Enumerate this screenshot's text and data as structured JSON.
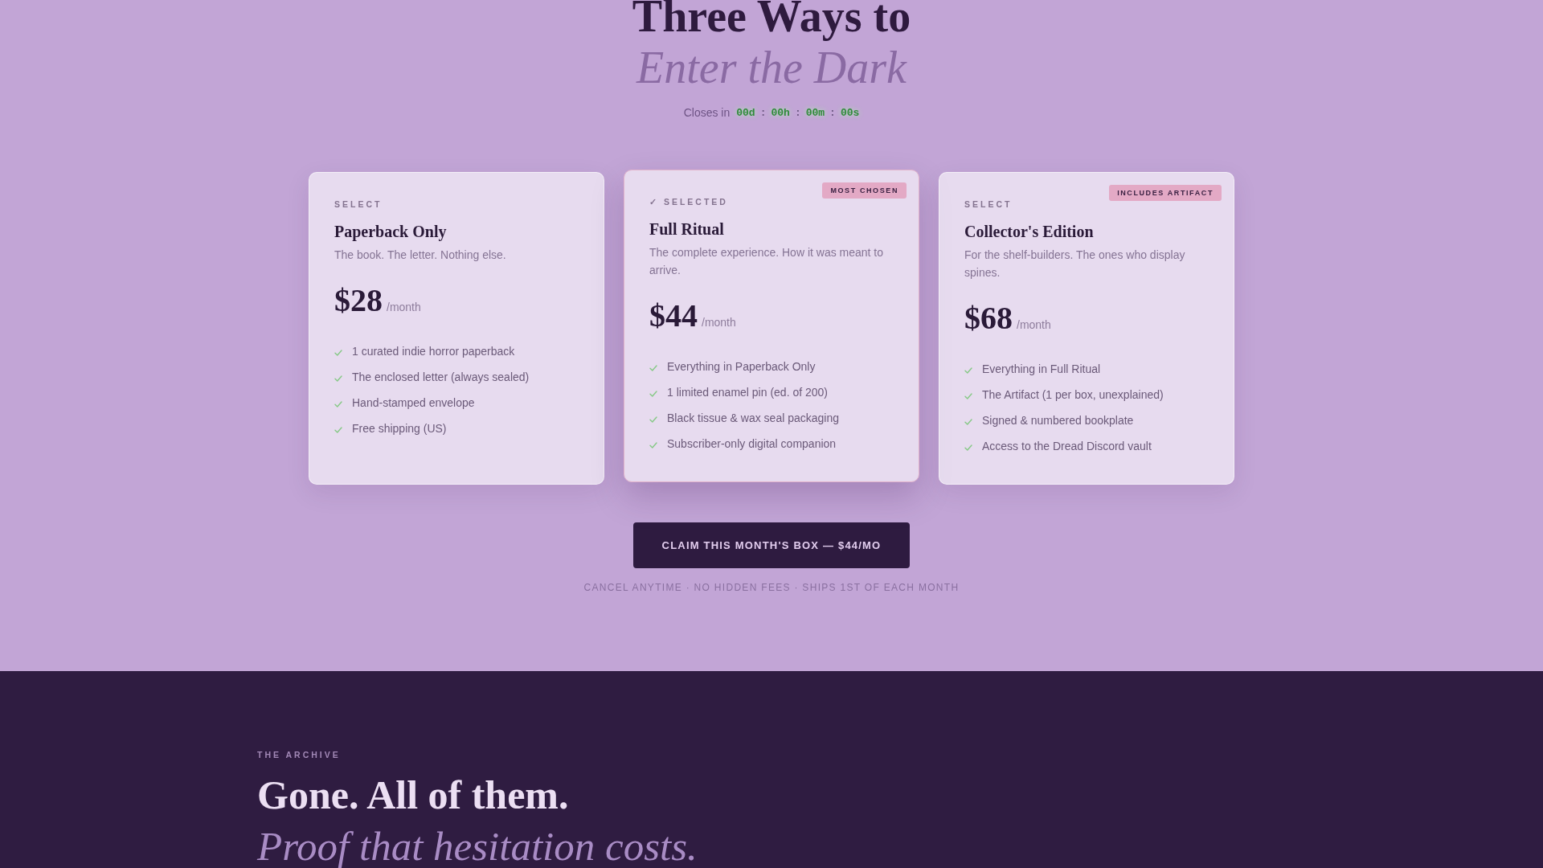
{
  "hero": {
    "title": "Three Ways to",
    "title_accent": "Enter the Dark",
    "countdown": {
      "label": "Closes in",
      "units": [
        "00d",
        "00h",
        "00m",
        "00s"
      ],
      "separator": ":"
    }
  },
  "plans": [
    {
      "select_label": "SELECT",
      "selected": false,
      "name": "Paperback Only",
      "description": "The book. The letter. Nothing else.",
      "price": "$28",
      "period": "/month",
      "features": [
        "1 curated indie horror paperback",
        "The enclosed letter (always sealed)",
        "Hand-stamped envelope",
        "Free shipping (US)"
      ]
    },
    {
      "select_label": "✓ SELECTED",
      "selected": true,
      "badge": "MOST CHOSEN",
      "name": "Full Ritual",
      "description": "The complete experience. How it was meant to arrive.",
      "price": "$44",
      "period": "/month",
      "features": [
        "Everything in Paperback Only",
        "1 limited enamel pin (ed. of 200)",
        "Black tissue & wax seal packaging",
        "Subscriber-only digital companion"
      ]
    },
    {
      "select_label": "SELECT",
      "selected": false,
      "badge": "INCLUDES ARTIFACT",
      "name": "Collector's Edition",
      "description": "For the shelf-builders. The ones who display spines.",
      "price": "$68",
      "period": "/month",
      "features": [
        "Everything in Full Ritual",
        "The Artifact (1 per box, unexplained)",
        "Signed & numbered bookplate",
        "Access to the Dread Discord vault"
      ]
    }
  ],
  "cta": {
    "button": "CLAIM THIS MONTH'S BOX — $44/MO",
    "note": "CANCEL ANYTIME · NO HIDDEN FEES · SHIPS 1ST OF EACH MONTH"
  },
  "archive": {
    "eyebrow": "THE ARCHIVE",
    "title": "Gone. All of them.",
    "title_accent": "Proof that hesitation costs."
  }
}
